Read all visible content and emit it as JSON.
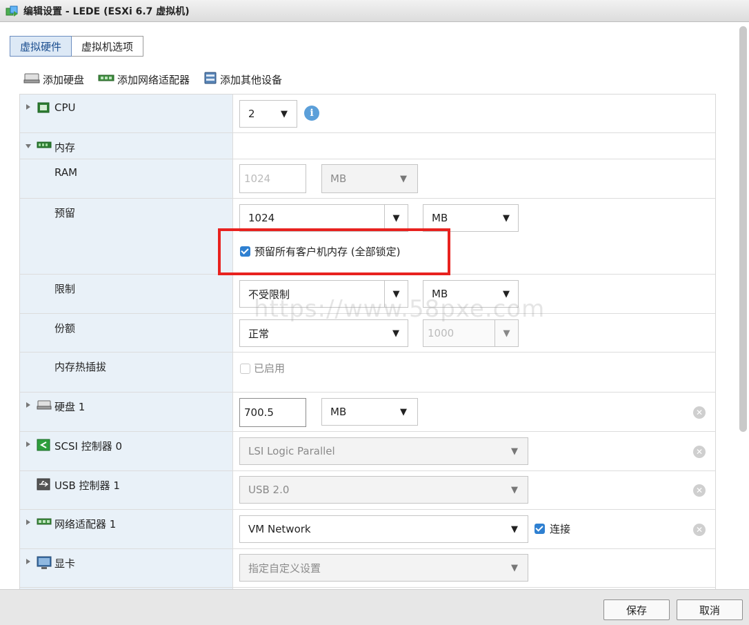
{
  "window": {
    "title": "编辑设置 - LEDE (ESXi 6.7 虚拟机)"
  },
  "tabs": [
    {
      "label": "虚拟硬件",
      "active": true
    },
    {
      "label": "虚拟机选项",
      "active": false
    }
  ],
  "toolbar": {
    "add_disk": "添加硬盘",
    "add_network": "添加网络适配器",
    "add_other": "添加其他设备"
  },
  "cpu": {
    "label": "CPU",
    "value": "2"
  },
  "memory": {
    "label": "内存",
    "ram": {
      "label": "RAM",
      "value": "1024",
      "unit": "MB"
    },
    "reservation": {
      "label": "预留",
      "value": "1024",
      "unit": "MB",
      "lock_label": "预留所有客户机内存 (全部锁定)",
      "lock_checked": true
    },
    "limit": {
      "label": "限制",
      "value": "不受限制",
      "unit": "MB"
    },
    "shares": {
      "label": "份额",
      "value": "正常",
      "number": "1000"
    },
    "hotplug": {
      "label": "内存热插拔",
      "checkbox_label": "已启用",
      "checked": false
    }
  },
  "disk": {
    "label": "硬盘 1",
    "value": "700.5",
    "unit": "MB"
  },
  "scsi": {
    "label": "SCSI 控制器 0",
    "value": "LSI Logic Parallel"
  },
  "usb": {
    "label": "USB 控制器 1",
    "value": "USB 2.0"
  },
  "network": {
    "label": "网络适配器 1",
    "value": "VM Network",
    "connect_label": "连接",
    "connected": true
  },
  "video": {
    "label": "显卡",
    "value": "指定自定义设置"
  },
  "watermark": "https://www.58pxe.com",
  "footer": {
    "save": "保存",
    "cancel": "取消"
  },
  "colors": {
    "accent": "#2f80d1",
    "highlight": "#e8221f",
    "label_bg": "#e9f1f8"
  }
}
